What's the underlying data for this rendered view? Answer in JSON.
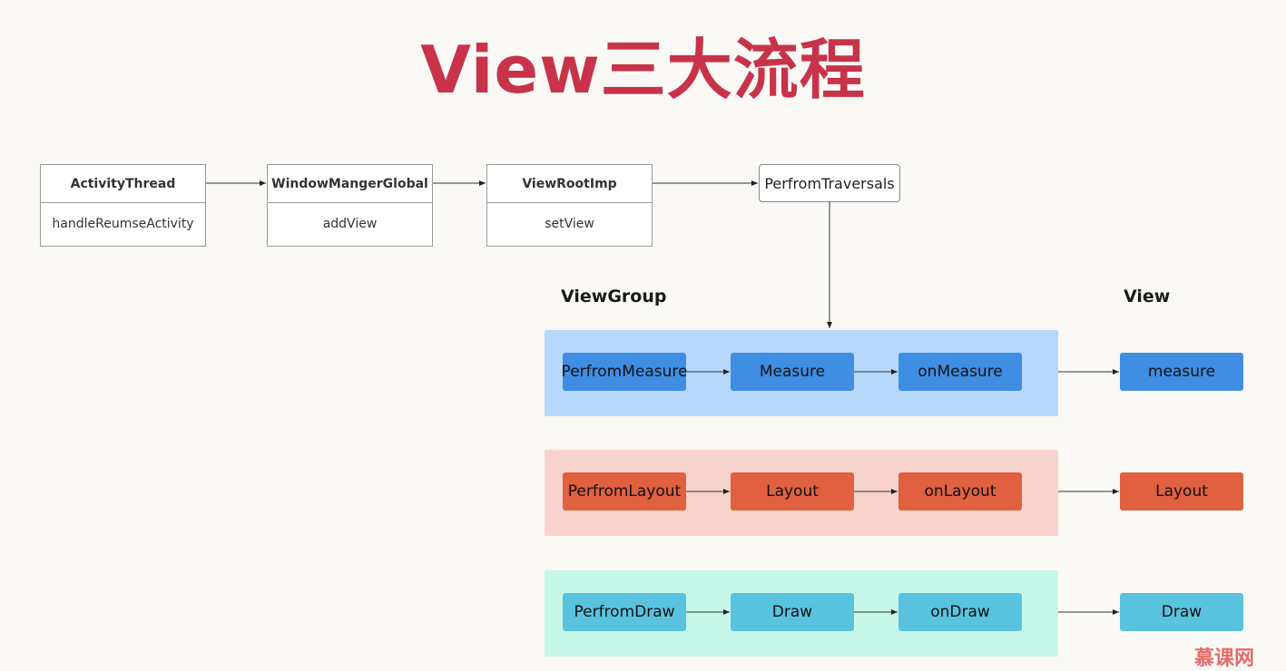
{
  "title": "View三大流程",
  "chain": [
    {
      "name": "ActivityThread",
      "method": "handleReumseActivity"
    },
    {
      "name": "WindowMangerGlobal",
      "method": "addView"
    },
    {
      "name": "ViewRootImp",
      "method": "setView"
    }
  ],
  "traversals": "PerfromTraversals",
  "columns": {
    "viewgroup": "ViewGroup",
    "view": "View"
  },
  "measure": {
    "steps": [
      "PerfromMeasure",
      "Measure",
      "onMeasure"
    ],
    "view": "measure",
    "band_color": "#b6d8fb",
    "box_color": "#3f8ee3"
  },
  "layout": {
    "steps": [
      "PerfromLayout",
      "Layout",
      "onLayout"
    ],
    "view": "Layout",
    "band_color": "#f8d3cd",
    "box_color": "#e0603f"
  },
  "draw": {
    "steps": [
      "PerfromDraw",
      "Draw",
      "onDraw"
    ],
    "view": "Draw",
    "band_color": "#c6f7e8",
    "box_color": "#59c3df"
  },
  "watermark": "慕课网"
}
